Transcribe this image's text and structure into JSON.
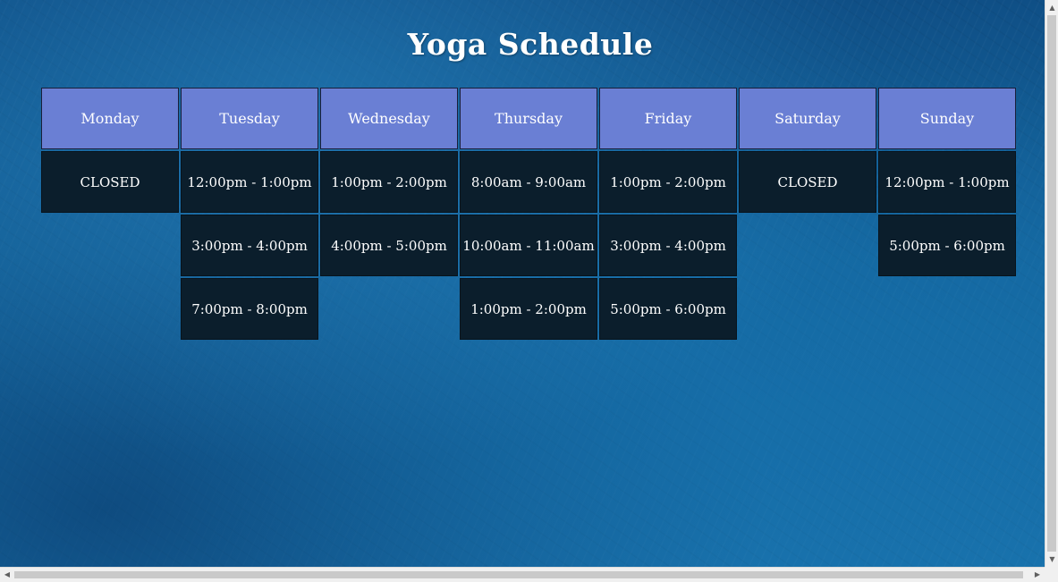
{
  "page": {
    "title": "Yoga Schedule"
  },
  "schedule": {
    "days": [
      {
        "name": "Monday",
        "slots": [
          "CLOSED"
        ]
      },
      {
        "name": "Tuesday",
        "slots": [
          "12:00pm - 1:00pm",
          "3:00pm - 4:00pm",
          "7:00pm - 8:00pm"
        ]
      },
      {
        "name": "Wednesday",
        "slots": [
          "1:00pm - 2:00pm",
          "4:00pm - 5:00pm"
        ]
      },
      {
        "name": "Thursday",
        "slots": [
          "8:00am - 9:00am",
          "10:00am - 11:00am",
          "1:00pm - 2:00pm"
        ]
      },
      {
        "name": "Friday",
        "slots": [
          "1:00pm - 2:00pm",
          "3:00pm - 4:00pm",
          "5:00pm - 6:00pm"
        ]
      },
      {
        "name": "Saturday",
        "slots": [
          "CLOSED"
        ]
      },
      {
        "name": "Sunday",
        "slots": [
          "12:00pm - 1:00pm",
          "5:00pm - 6:00pm"
        ]
      }
    ]
  },
  "scrollbars": {
    "up_icon": "triangle-up-icon",
    "down_icon": "triangle-down-icon",
    "left_icon": "triangle-left-icon",
    "right_icon": "triangle-right-icon"
  },
  "colors": {
    "header_bg": "#6a7fd4",
    "slot_bg": "#0b1e2c",
    "background": "#15679f",
    "text": "#ffffff"
  }
}
